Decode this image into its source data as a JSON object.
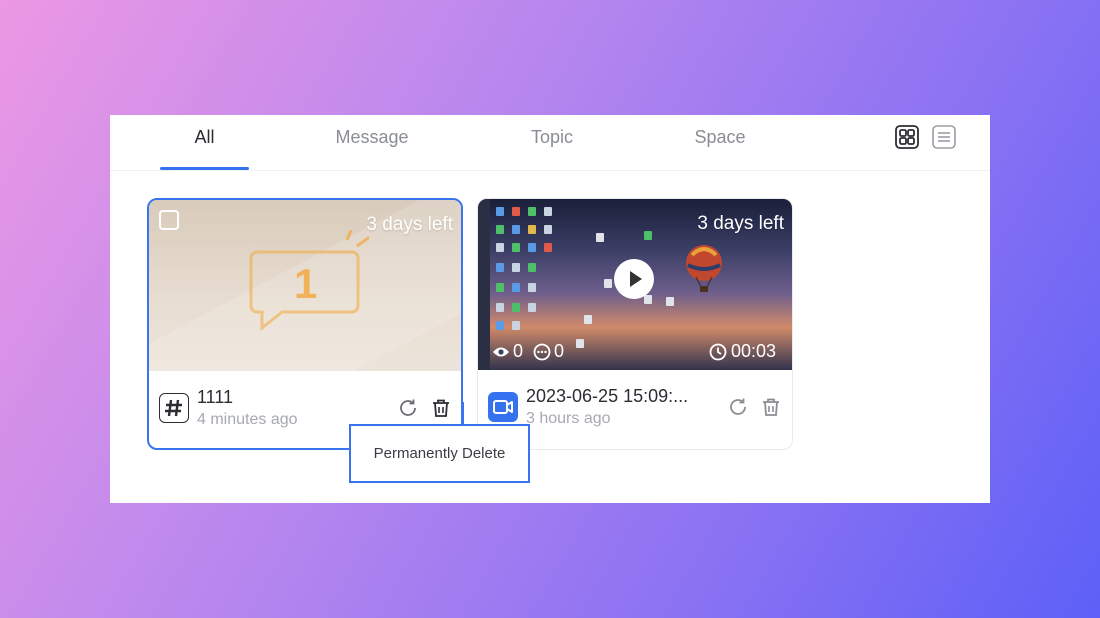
{
  "tabs": [
    {
      "label": "All",
      "active": true
    },
    {
      "label": "Message",
      "active": false
    },
    {
      "label": "Topic",
      "active": false
    },
    {
      "label": "Space",
      "active": false
    }
  ],
  "view_toggle": {
    "grid_icon": "grid-view-icon",
    "list_icon": "list-view-icon"
  },
  "cards": [
    {
      "type": "topic",
      "type_icon": "hashtag-icon",
      "badge": "3 days left",
      "thumbnail_number": "1",
      "title": "1111",
      "time": "4 minutes ago",
      "selected": true
    },
    {
      "type": "video",
      "type_icon": "video-camera-icon",
      "badge": "3 days left",
      "views": "0",
      "comments": "0",
      "duration": "00:03",
      "title": "2023-06-25 15:09:...",
      "time": "3 hours ago",
      "selected": false
    }
  ],
  "tooltip": {
    "text": "Permanently Delete"
  },
  "colors": {
    "accent": "#3572ef",
    "thumbnail_orange": "#f2a73b",
    "muted_text": "#a6a9b0"
  }
}
